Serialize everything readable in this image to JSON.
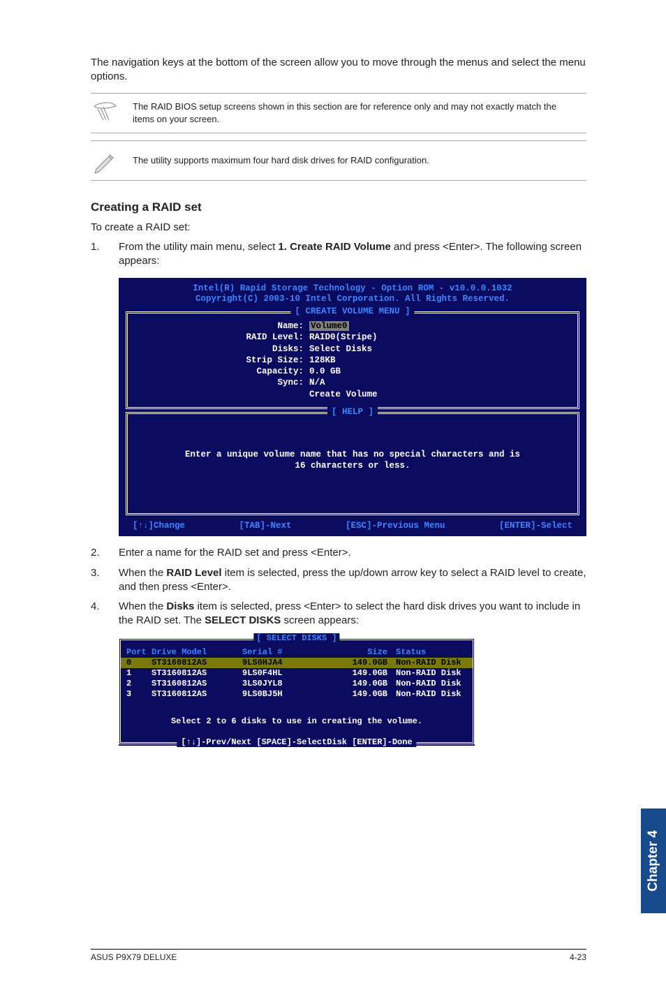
{
  "intro_para": "The navigation keys at the bottom of the screen allow you to move through the menus and select the menu options.",
  "note1": "The RAID BIOS setup screens shown in this section are for reference only and may not exactly match the items on your screen.",
  "note2": "The utility supports maximum four hard disk drives for RAID configuration.",
  "section_heading": "Creating a RAID set",
  "section_intro": "To create a RAID set:",
  "steps": [
    {
      "n": "1.",
      "pre": "From the utility main menu, select ",
      "bold": "1. Create RAID Volume",
      "post": " and press <Enter>. The following screen appears:"
    },
    {
      "n": "2.",
      "pre": "Enter a name for the RAID set and press <Enter>.",
      "bold": "",
      "post": ""
    },
    {
      "n": "3.",
      "pre": "When the ",
      "bold": "RAID Level",
      "post": " item is selected, press the up/down arrow key to select a RAID level to create, and then press <Enter>."
    },
    {
      "n": "4.",
      "pre": "When the ",
      "bold": "Disks",
      "post": " item is selected, press <Enter> to select the hard disk drives you want to include in the RAID set. The ",
      "bold2": "SELECT DISKS",
      "post2": " screen appears:"
    }
  ],
  "bios1": {
    "title1": "Intel(R) Rapid Storage Technology - Option ROM - v10.0.0.1032",
    "title2": "Copyright(C) 2003-10 Intel Corporation.  All Rights Reserved.",
    "box_title": "[ CREATE VOLUME MENU ]",
    "fields": [
      {
        "k": "Name:",
        "v": "Volume0",
        "hl": true
      },
      {
        "k": "RAID Level:",
        "v": "RAID0(Stripe)"
      },
      {
        "k": "Disks:",
        "v": "Select Disks"
      },
      {
        "k": "Strip Size:",
        "v": " 128KB"
      },
      {
        "k": "Capacity:",
        "v": "0.0   GB"
      },
      {
        "k": "Sync:",
        "v": "N/A"
      },
      {
        "k": "",
        "v": "Create Volume"
      }
    ],
    "help_title": "[ HELP ]",
    "help_l1": "Enter a unique volume name that has no special characters and is",
    "help_l2": "16 characters or less.",
    "footer": {
      "a": "[↑↓]Change",
      "b": "[TAB]-Next",
      "c": "[ESC]-Previous Menu",
      "d": "[ENTER]-Select"
    }
  },
  "bios2": {
    "title": "[ SELECT DISKS ]",
    "header": {
      "port": "Port",
      "model": "Drive Model",
      "serial": "Serial #",
      "size": "Size",
      "status": "Status"
    },
    "rows": [
      {
        "port": "0",
        "model": "ST3160812AS",
        "serial": "9LS0HJA4",
        "size": "149.0GB",
        "status": "Non-RAID Disk",
        "hl": true
      },
      {
        "port": "1",
        "model": "ST3160812AS",
        "serial": "9LS0F4HL",
        "size": "149.0GB",
        "status": "Non-RAID Disk"
      },
      {
        "port": "2",
        "model": "ST3160812AS",
        "serial": "3LS0JYL8",
        "size": "149.0GB",
        "status": "Non-RAID Disk"
      },
      {
        "port": "3",
        "model": "ST3160812AS",
        "serial": "9LS0BJ5H",
        "size": "149.0GB",
        "status": "Non-RAID Disk"
      }
    ],
    "note": "Select 2 to 6 disks to use in creating the volume.",
    "footer": "[↑↓]-Prev/Next [SPACE]-SelectDisk [ENTER]-Done"
  },
  "sidetab": "Chapter 4",
  "footer_left": "ASUS P9X79 DELUXE",
  "footer_right": "4-23"
}
